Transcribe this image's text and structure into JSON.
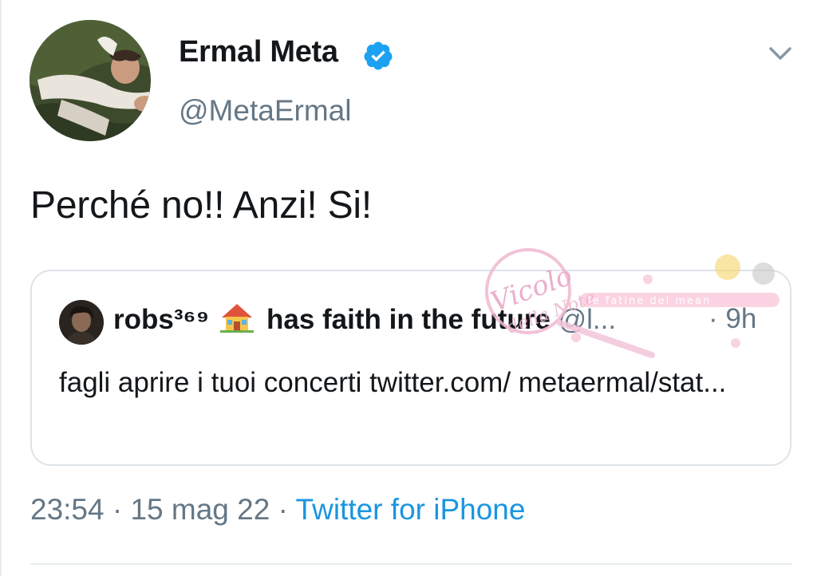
{
  "tweet": {
    "display_name": "Ermal Meta",
    "handle": "@MetaErmal",
    "verified": true,
    "text": "Perché no!! Anzi! Si!",
    "timestamp": "23:54 · 15 mag 22",
    "separator": " · ",
    "source": "Twitter for iPhone"
  },
  "quoted_tweet": {
    "name": "robs³⁶⁹",
    "emoji_icon": "house-with-garden-icon",
    "name_suffix": "has faith in the future",
    "handle": "@l...",
    "time": "· 9h",
    "text": "fagli aprire i tuoi concerti twitter.com/ metaermal/stat..."
  },
  "watermark": {
    "script": "Vicolo della Note",
    "banner": "le fatine dei mean"
  },
  "colors": {
    "text": "#14171a",
    "secondary": "#657786",
    "link": "#1b95e0",
    "verified": "#1da1f2",
    "border": "#dde3e8"
  }
}
